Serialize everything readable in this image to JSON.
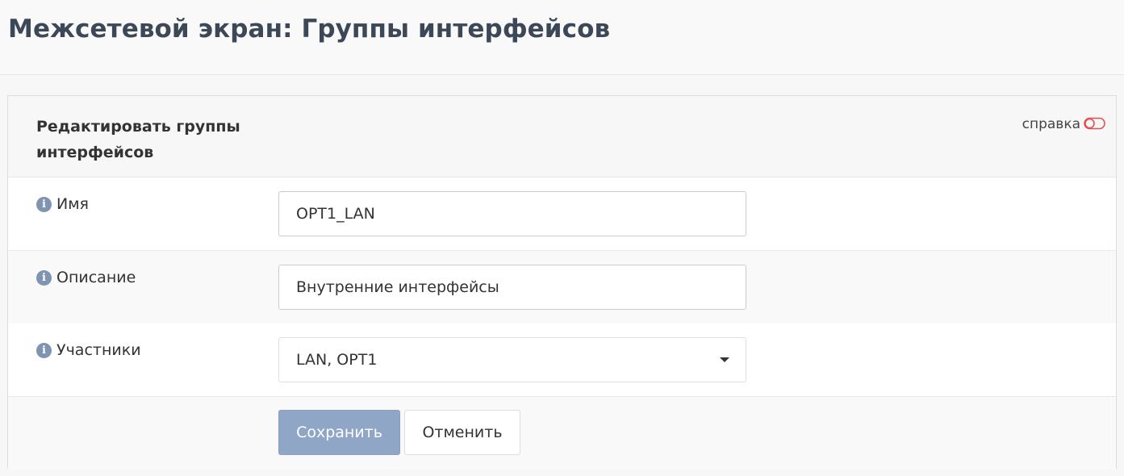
{
  "page": {
    "title": "Межсетевой экран: Группы интерфейсов"
  },
  "panel": {
    "title": "Редактировать группы интерфейсов",
    "help_label": "справка",
    "help_icon": "toggle-icon"
  },
  "form": {
    "name": {
      "label": "Имя",
      "value": "OPT1_LAN",
      "icon": "info-icon"
    },
    "description": {
      "label": "Описание",
      "value": "Внутренние интерфейсы",
      "icon": "info-icon"
    },
    "members": {
      "label": "Участники",
      "value": "LAN, OPT1",
      "icon": "info-icon"
    }
  },
  "actions": {
    "save_label": "Сохранить",
    "cancel_label": "Отменить"
  },
  "colors": {
    "title": "#3c4858",
    "primary_button": "#8fa6c7",
    "help_toggle": "#e05252",
    "info_icon": "#7f94b0"
  }
}
